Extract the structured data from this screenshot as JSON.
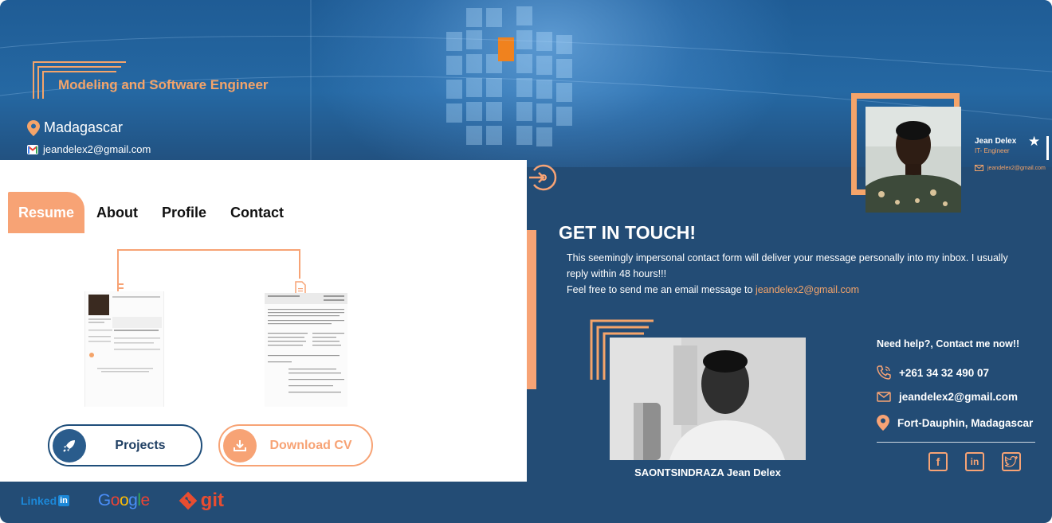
{
  "header": {
    "tagline": "Modeling and Software Engineer",
    "location": "Madagascar",
    "email": "jeandelex2@gmail.com"
  },
  "profile_card": {
    "name": "Jean Delex",
    "role": "IT- Engineer",
    "email": "jeandelex2@gmail.com"
  },
  "tabs": [
    {
      "label": "Resume",
      "active": true
    },
    {
      "label": "About",
      "active": false
    },
    {
      "label": "Profile",
      "active": false
    },
    {
      "label": "Contact",
      "active": false
    }
  ],
  "buttons": {
    "projects": "Projects",
    "download": "Download CV"
  },
  "footer": {
    "linkedin": "Linked",
    "linkedin_box": "in",
    "google": "Google",
    "git": "git"
  },
  "contact": {
    "title": "GET IN TOUCH!",
    "text1": "This seemingly impersonal contact form will deliver your message personally into my inbox. I usually reply within 48 hours!!!",
    "text2": "Feel free to send me an email message to",
    "email_link": "jeandelex2@gmail.com",
    "photo_caption": "SAONTSINDRAZA Jean Delex",
    "help_title": "Need help?, Contact me now!!",
    "phone": "+261 34 32 490 07",
    "email": "jeandelex2@gmail.com",
    "address": "Fort-Dauphin, Madagascar"
  },
  "colors": {
    "accent": "#f7a375",
    "navy": "#234c75"
  }
}
